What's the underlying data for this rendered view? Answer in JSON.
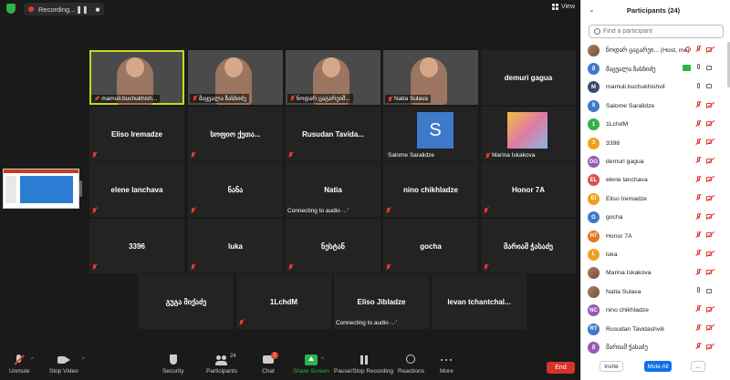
{
  "topbar": {
    "recording_label": "Recording...",
    "pause_glyph": "❚❚",
    "stop_glyph": "■",
    "view_label": "View"
  },
  "tiles": [
    {
      "name": "mamuli.buchukhish...",
      "video": true,
      "mute": false,
      "pinned": true
    },
    {
      "name": "მაყვალა ზასხიძე",
      "video": true,
      "mute": true
    },
    {
      "name": "ნოდარ ცაგარეიშ...",
      "video": true,
      "mute": true
    },
    {
      "name": "Natia Sulava",
      "video": true,
      "mute": true
    },
    {
      "name": "demuri gagua",
      "mute": false
    },
    {
      "name": "Eliso Iremadze",
      "mute": true
    },
    {
      "name": "სოფიო ქეთა...",
      "mute": true
    },
    {
      "name": "Rusudan Tavida...",
      "mute": true
    },
    {
      "name": "Salome Saralidze",
      "avatar": "S",
      "mute": false
    },
    {
      "name": "Marina Iskakova",
      "photo": true,
      "mute": true
    },
    {
      "name": "elene lanchava",
      "mute": true
    },
    {
      "name": "ნანა",
      "mute": true
    },
    {
      "name": "Natia",
      "status": "Connecting to audio ·.·'"
    },
    {
      "name": "nino chikhladze",
      "mute": true
    },
    {
      "name": "Honor 7A",
      "mute": true
    },
    {
      "name": "3396",
      "mute": true
    },
    {
      "name": "luka",
      "mute": true
    },
    {
      "name": "ნესტან",
      "mute": true
    },
    {
      "name": "gocha",
      "mute": true
    },
    {
      "name": "მარიამ ჭასაძე",
      "mute": true
    },
    {
      "name": "გუგა მიქაძე",
      "mute": false
    },
    {
      "name": "1LchdM",
      "mute": true
    },
    {
      "name": "Eliso Jibladze",
      "status": "Connecting to audio ·.·'"
    },
    {
      "name": "levan  tchantchal...",
      "mute": false
    }
  ],
  "toolbar": {
    "unmute": "Unmute",
    "stop_video": "Stop Video",
    "security": "Security",
    "participants": "Participants",
    "participants_count": "24",
    "chat": "Chat",
    "chat_badge": "1",
    "share_screen": "Share Screen",
    "pause_recording": "Pause/Stop Recording",
    "reactions": "Reactions",
    "more": "More",
    "end": "End"
  },
  "panel": {
    "title": "Participants (24)",
    "search_placeholder": "Find a participant",
    "invite": "Invite",
    "mute_all": "Mute All",
    "more": "...",
    "participants": [
      {
        "initial": "",
        "color": "",
        "image": true,
        "name": "ნოდარ ცაგარეი... (Host, me)",
        "mic": "off",
        "cam": "off",
        "rec": true
      },
      {
        "initial": "მ",
        "color": "#3f79c9",
        "name": "მაყვალა ზასხიძე",
        "mic": "on",
        "cam": "on",
        "share": true
      },
      {
        "initial": "M",
        "color": "#3a4a6b",
        "name": "mamuli.buchukhishvil",
        "mic": "on",
        "cam": "on"
      },
      {
        "initial": "S",
        "color": "#3f79c9",
        "name": "Salome Saralidze",
        "mic": "off",
        "cam": "off"
      },
      {
        "initial": "1",
        "color": "#2fb24b",
        "name": "1LchdM",
        "mic": "off",
        "cam": "off"
      },
      {
        "initial": "3",
        "color": "#f0a020",
        "name": "3396",
        "mic": "off",
        "cam": "off"
      },
      {
        "initial": "DG",
        "color": "#9b59b6",
        "name": "demuri gagua",
        "mic": "off",
        "cam": "off"
      },
      {
        "initial": "EL",
        "color": "#d9534f",
        "name": "elene lanchava",
        "mic": "off",
        "cam": "off"
      },
      {
        "initial": "EI",
        "color": "#f0a020",
        "name": "Eliso Iremadze",
        "mic": "off",
        "cam": "off"
      },
      {
        "initial": "G",
        "color": "#3f79c9",
        "name": "gocha",
        "mic": "off",
        "cam": "off"
      },
      {
        "initial": "H7",
        "color": "#e07a20",
        "name": "Honor 7A",
        "mic": "off",
        "cam": "off"
      },
      {
        "initial": "L",
        "color": "#f0a020",
        "name": "luka",
        "mic": "off",
        "cam": "off"
      },
      {
        "initial": "",
        "color": "",
        "image": true,
        "name": "Marina Iskakova",
        "mic": "off",
        "cam": "off"
      },
      {
        "initial": "",
        "color": "",
        "image": true,
        "name": "Natia Sulava",
        "mic": "on",
        "cam": "on"
      },
      {
        "initial": "NC",
        "color": "#9b59b6",
        "name": "nino chikhladze",
        "mic": "off",
        "cam": "off"
      },
      {
        "initial": "RT",
        "color": "#3f79c9",
        "name": "Rusudan Tavidashvili",
        "mic": "off",
        "cam": "off"
      },
      {
        "initial": "მ",
        "color": "#9b59b6",
        "name": "მარიამ ჭასაძე",
        "mic": "off",
        "cam": "off"
      }
    ]
  }
}
